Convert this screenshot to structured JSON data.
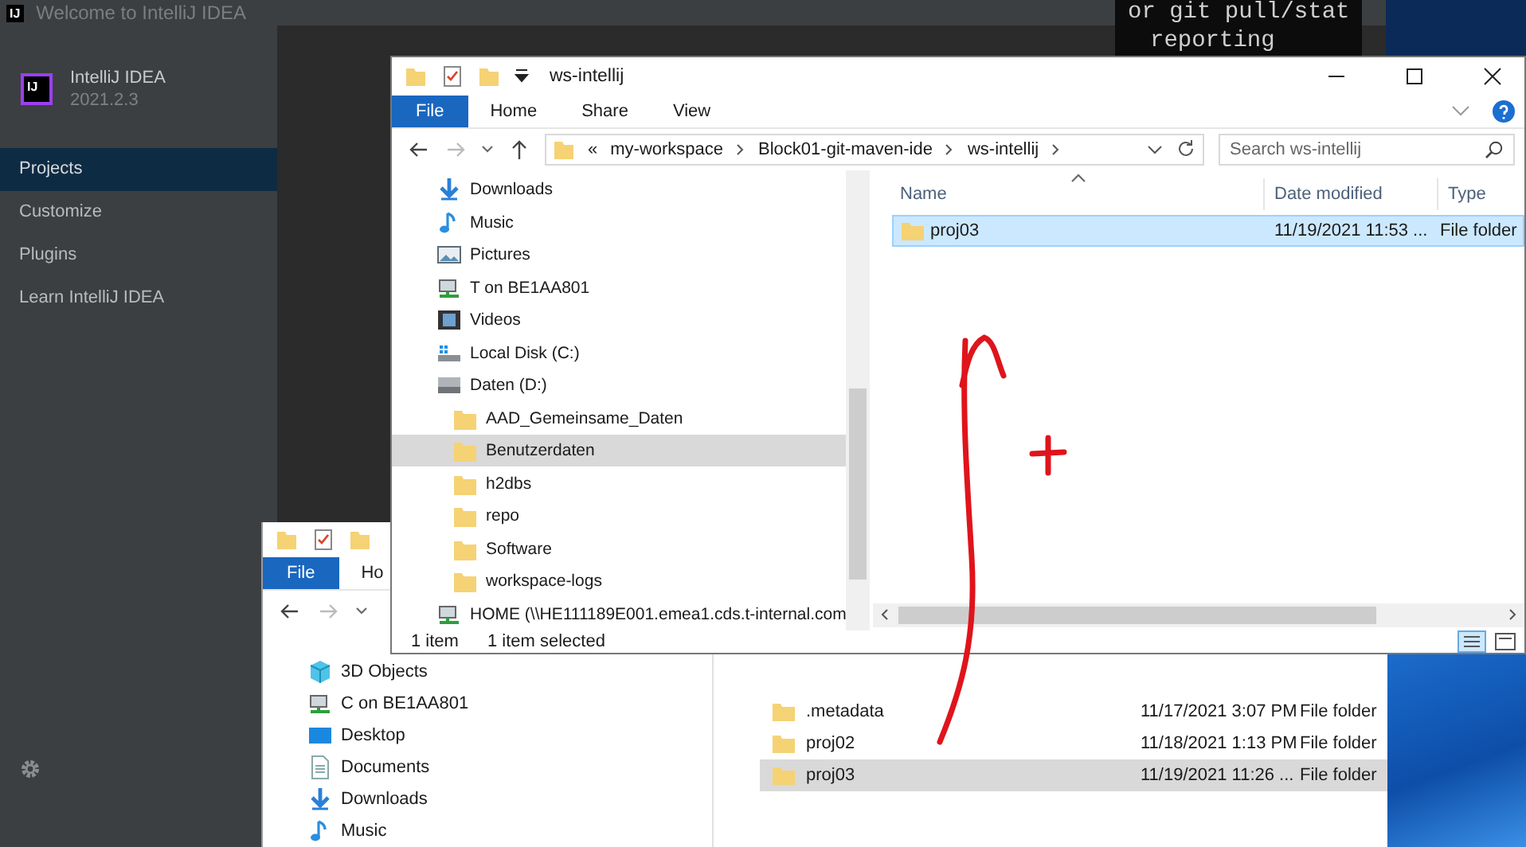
{
  "intellij": {
    "title_logo": "IJ",
    "title": "Welcome to IntelliJ IDEA",
    "logo": "IJ",
    "product": "IntelliJ IDEA",
    "version": "2021.2.3",
    "nav": [
      {
        "label": "Projects",
        "selected": true
      },
      {
        "label": "Customize",
        "selected": false
      },
      {
        "label": "Plugins",
        "selected": false
      },
      {
        "label": "Learn IntelliJ IDEA",
        "selected": false
      }
    ]
  },
  "terminal": {
    "lines": [
      "or git pull/stat",
      "reporting"
    ]
  },
  "explorer_back": {
    "active": false,
    "ribbon_tabs": [
      {
        "label": "File",
        "selected": true
      },
      {
        "label": "Ho",
        "selected": false
      }
    ],
    "nav": [
      {
        "label": "3D Objects",
        "kind": "objects",
        "selected": false
      },
      {
        "label": "C on BE1AA801",
        "kind": "network",
        "selected": false
      },
      {
        "label": "Desktop",
        "kind": "desktop",
        "selected": false
      },
      {
        "label": "Documents",
        "kind": "documents",
        "selected": false
      },
      {
        "label": "Downloads",
        "kind": "downloads",
        "selected": false
      },
      {
        "label": "Music",
        "kind": "music",
        "selected": false
      }
    ],
    "rows": [
      {
        "name": ".metadata",
        "date": "11/17/2021 3:07 PM",
        "type": "File folder",
        "selected": false
      },
      {
        "name": "proj02",
        "date": "11/18/2021 1:13 PM",
        "type": "File folder",
        "selected": false
      },
      {
        "name": "proj03",
        "date": "11/19/2021 11:26 ...",
        "type": "File folder",
        "selected": true
      }
    ]
  },
  "explorer_front": {
    "active": true,
    "title": "ws-intellij",
    "ribbon_tabs": [
      {
        "label": "File",
        "selected": true
      },
      {
        "label": "Home",
        "selected": false
      },
      {
        "label": "Share",
        "selected": false
      },
      {
        "label": "View",
        "selected": false
      }
    ],
    "address_overflow": "«",
    "breadcrumb": [
      "my-workspace",
      "Block01-git-maven-ide",
      "ws-intellij"
    ],
    "search": {
      "placeholder": "Search ws-intellij"
    },
    "nav": [
      {
        "label": "Downloads",
        "kind": "downloads",
        "selected": false
      },
      {
        "label": "Music",
        "kind": "music",
        "selected": false
      },
      {
        "label": "Pictures",
        "kind": "pictures",
        "selected": false
      },
      {
        "label": "T on BE1AA801",
        "kind": "network",
        "selected": false
      },
      {
        "label": "Videos",
        "kind": "videos",
        "selected": false
      },
      {
        "label": "Local Disk (C:)",
        "kind": "localdisk",
        "selected": false
      },
      {
        "label": "Daten (D:)",
        "kind": "drive",
        "selected": false,
        "children": [
          {
            "label": "AAD_Gemeinsame_Daten",
            "kind": "folder",
            "selected": false
          },
          {
            "label": "Benutzerdaten",
            "kind": "folder",
            "selected": true
          },
          {
            "label": "h2dbs",
            "kind": "folder",
            "selected": false
          },
          {
            "label": "repo",
            "kind": "folder",
            "selected": false
          },
          {
            "label": "Software",
            "kind": "folder",
            "selected": false
          },
          {
            "label": "workspace-logs",
            "kind": "folder",
            "selected": false
          }
        ]
      },
      {
        "label": "HOME (\\\\HE111189E001.emea1.cds.t-internal.com",
        "kind": "network",
        "selected": false
      }
    ],
    "columns": [
      "Name",
      "Date modified",
      "Type"
    ],
    "rows": [
      {
        "name": "proj03",
        "date": "11/19/2021 11:53 ...",
        "type": "File folder",
        "selected": true
      }
    ],
    "status": {
      "items": "1 item",
      "selected": "1 item selected"
    }
  }
}
